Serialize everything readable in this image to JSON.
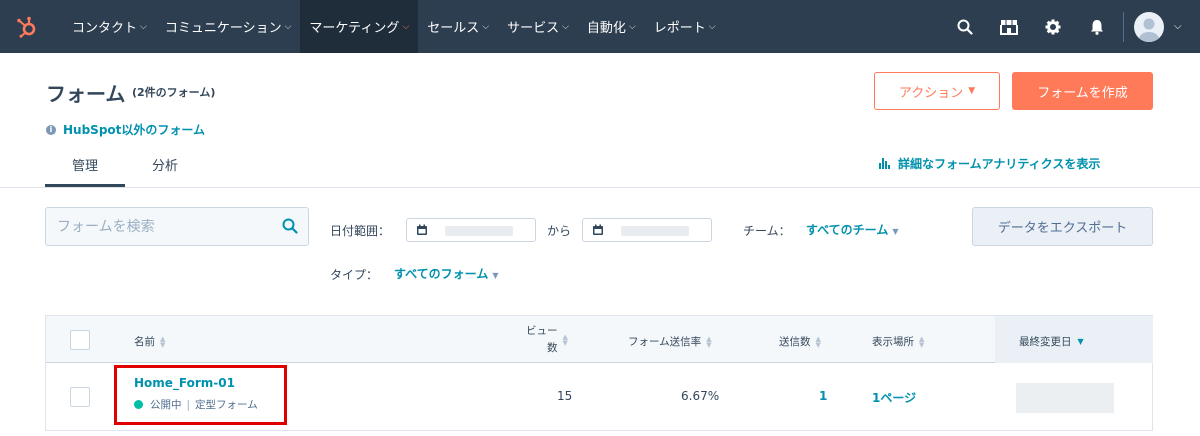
{
  "nav": {
    "items": [
      {
        "label": "コンタクト"
      },
      {
        "label": "コミュニケーション"
      },
      {
        "label": "マーケティング",
        "active": true
      },
      {
        "label": "セールス"
      },
      {
        "label": "サービス"
      },
      {
        "label": "自動化"
      },
      {
        "label": "レポート"
      }
    ],
    "icons": [
      "search-icon",
      "marketplace-icon",
      "gear-icon",
      "bell-icon"
    ]
  },
  "header": {
    "title": "フォーム",
    "count": "(2件のフォーム)",
    "action_label": "アクション",
    "create_label": "フォームを作成",
    "external_link": "HubSpot以外のフォーム"
  },
  "tabs": [
    {
      "label": "管理",
      "active": true
    },
    {
      "label": "分析"
    }
  ],
  "analytics_link": "詳細なフォームアナリティクスを表示",
  "filters": {
    "search_placeholder": "フォームを検索",
    "date_label": "日付範囲：",
    "date_sep": "から",
    "team_label": "チーム：",
    "team_value": "すべてのチーム",
    "type_label": "タイプ：",
    "type_value": "すべてのフォーム",
    "export_label": "データをエクスポート"
  },
  "table": {
    "columns": {
      "name": "名前",
      "views_line1": "ビュー",
      "views_line2": "数",
      "rate": "フォーム送信率",
      "submissions": "送信数",
      "location": "表示場所",
      "updated": "最終変更日"
    },
    "rows": [
      {
        "name": "Home_Form-01",
        "status": "公開中",
        "form_type": "定型フォーム",
        "views": "15",
        "rate": "6.67%",
        "submissions": "1",
        "location": "1ページ"
      }
    ]
  },
  "colors": {
    "nav_bg": "#2d3e50",
    "accent": "#ff7a59",
    "link": "#0091ae",
    "status_published": "#00bda5",
    "highlight": "#e00000"
  }
}
